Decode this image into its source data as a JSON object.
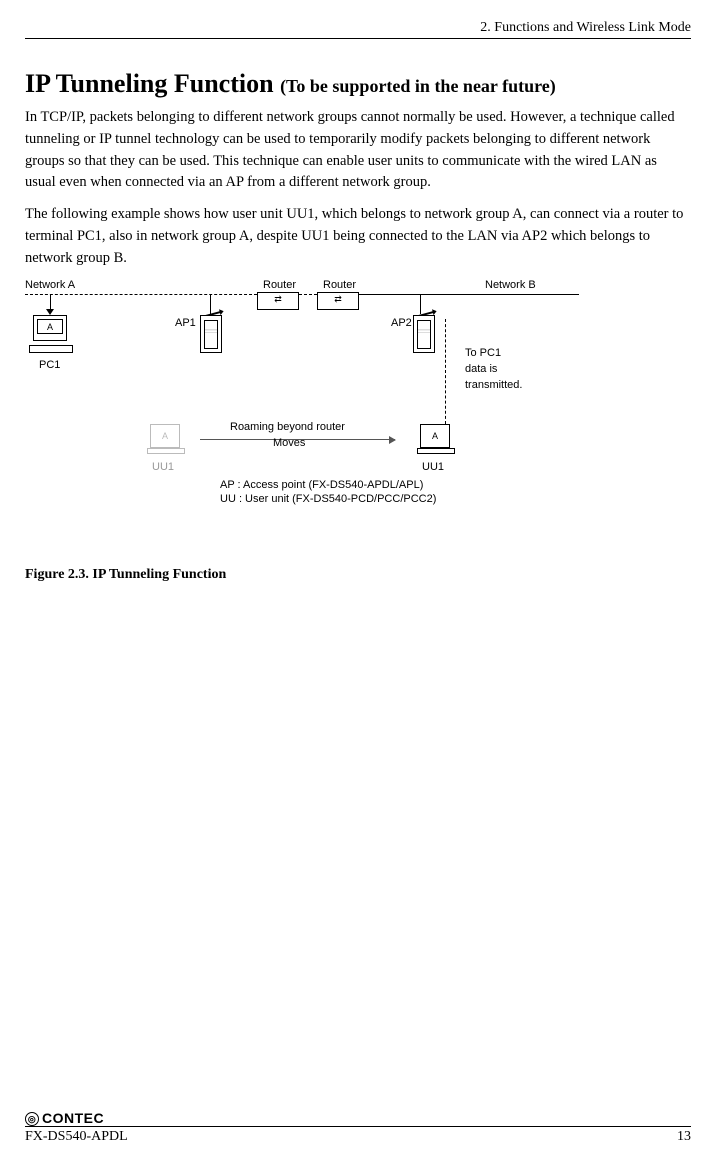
{
  "header": {
    "chapter": "2.  Functions and Wireless Link Mode"
  },
  "title": {
    "main": "IP Tunneling Function ",
    "sub": "(To be supported in the near future)"
  },
  "paragraph1": "In TCP/IP, packets belonging to different network groups cannot normally be used.  However, a technique called tunneling or IP tunnel technology can be used to temporarily modify packets belonging to different network groups so that they can be used.  This technique can enable user units to communicate with the wired LAN as usual even when connected via an AP from a different network group.",
  "paragraph2": "The following example shows how user unit UU1, which belongs to network group A, can connect via a router to terminal PC1, also in network group A, despite UU1 being connected to the LAN via AP2 which belongs to network group B.",
  "diagram": {
    "networkA": "Network A",
    "networkB": "Network B",
    "router": "Router",
    "pc1": "PC1",
    "pc1_badge": "A",
    "ap1": "AP1",
    "ap2": "AP2",
    "to_pc1_line1": "To PC1",
    "to_pc1_line2": "data is",
    "to_pc1_line3": "transmitted.",
    "uu1": "UU1",
    "uu1_badge": "A",
    "roaming": "Roaming beyond router",
    "moves": "Moves",
    "legend_ap": "AP  : Access point (FX-DS540-APDL/APL)",
    "legend_uu": "UU : User unit (FX-DS540-PCD/PCC/PCC2)"
  },
  "figure_caption": "Figure 2.3.  IP Tunneling Function",
  "footer": {
    "brand": "CONTEC",
    "model": "FX-DS540-APDL",
    "page": "13"
  }
}
